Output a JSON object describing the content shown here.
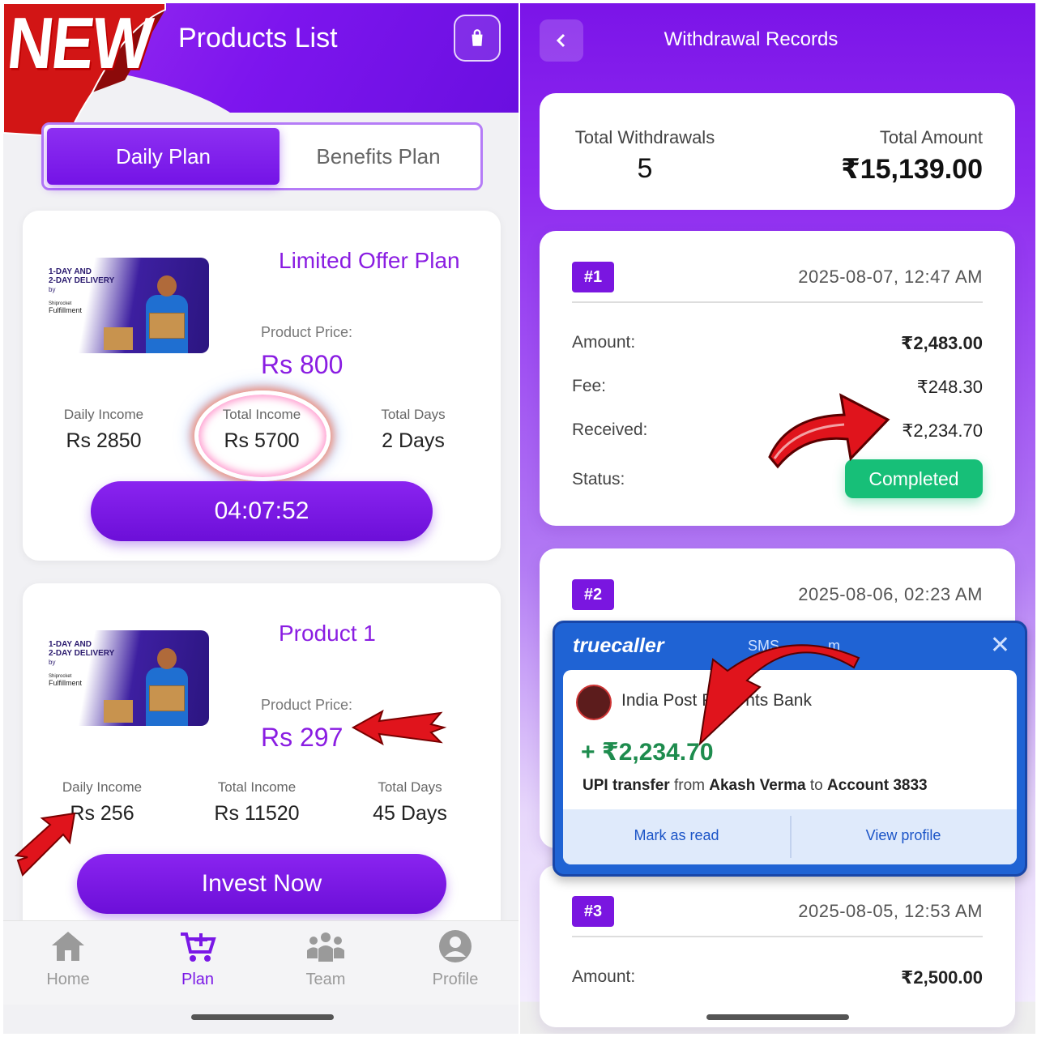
{
  "left": {
    "banner": "NEW",
    "title": "Products List",
    "tabs": [
      {
        "label": "Daily Plan",
        "active": true
      },
      {
        "label": "Benefits Plan",
        "active": false
      }
    ],
    "thumb": {
      "headline_1": "1-DAY AND",
      "headline_2": "2-DAY DELIVERY",
      "by": "by",
      "brand_1": "Shiprocket",
      "brand_2": "Fulfillment"
    },
    "products": [
      {
        "title": "Limited Offer Plan",
        "price_label": "Product Price:",
        "price": "Rs 800",
        "daily_income_label": "Daily Income",
        "daily_income": "Rs 2850",
        "total_income_label": "Total Income",
        "total_income": "Rs 5700",
        "total_days_label": "Total Days",
        "total_days": "2 Days",
        "button": "04:07:52"
      },
      {
        "title": "Product 1",
        "price_label": "Product Price:",
        "price": "Rs 297",
        "daily_income_label": "Daily Income",
        "daily_income": "Rs 256",
        "total_income_label": "Total Income",
        "total_income": "Rs 11520",
        "total_days_label": "Total Days",
        "total_days": "45 Days",
        "button": "Invest Now"
      }
    ],
    "nav": [
      {
        "label": "Home",
        "icon": "home-icon",
        "active": false
      },
      {
        "label": "Plan",
        "icon": "cart-icon",
        "active": true
      },
      {
        "label": "Team",
        "icon": "team-icon",
        "active": false
      },
      {
        "label": "Profile",
        "icon": "profile-icon",
        "active": false
      }
    ]
  },
  "right": {
    "title": "Withdrawal Records",
    "summary": {
      "count_label": "Total Withdrawals",
      "count": "5",
      "amount_label": "Total Amount",
      "amount": "₹15,139.00"
    },
    "records": [
      {
        "badge": "#1",
        "date": "2025-08-07, 12:47 AM",
        "amount_label": "Amount:",
        "amount": "₹2,483.00",
        "fee_label": "Fee:",
        "fee": "₹248.30",
        "received_label": "Received:",
        "received": "₹2,234.70",
        "status_label": "Status:",
        "status": "Completed"
      },
      {
        "badge": "#2",
        "date": "2025-08-06, 02:23 AM"
      },
      {
        "badge": "#3",
        "date": "2025-08-05, 12:53 AM",
        "amount_label": "Amount:",
        "amount": "₹2,500.00"
      }
    ],
    "truecaller": {
      "logo": "truecaller",
      "meta": "SMS",
      "meta_tail": "m",
      "sender": "India Post P",
      "sender_tail": "nts Bank",
      "amount": "+ ₹2,234.70",
      "msg_1": "UPI transfer",
      "msg_2": "from",
      "msg_3": "Akash Verma",
      "msg_4": "to",
      "msg_5": "Account 3833",
      "mark_read": "Mark as read",
      "view_profile": "View profile"
    }
  },
  "colors": {
    "brand_purple": "#7a16e0",
    "status_green": "#17bf78",
    "truecaller_blue": "#1f63d4",
    "arrow_red": "#e0141c"
  }
}
